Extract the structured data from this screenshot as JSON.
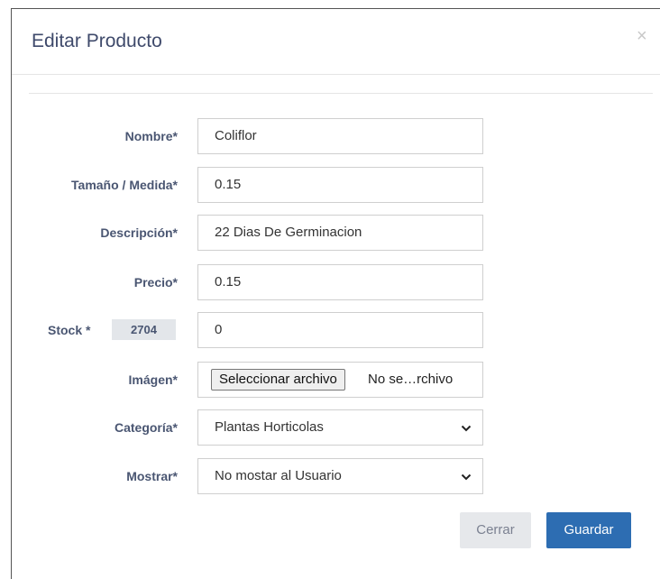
{
  "modal": {
    "title": "Editar Producto",
    "close_glyph": "×"
  },
  "form": {
    "nombre": {
      "label": "Nombre*",
      "value": "Coliflor"
    },
    "tamano": {
      "label": "Tamaño / Medida*",
      "value": "0.15"
    },
    "descripcion": {
      "label": "Descripción*",
      "value": "22 Dias De Germinacion"
    },
    "precio": {
      "label": "Precio*",
      "value": "0.15"
    },
    "stock": {
      "label": "Stock *",
      "current": "2704",
      "value": "0"
    },
    "imagen": {
      "label": "Imágen*",
      "button": "Seleccionar archivo",
      "filename": "No se…rchivo"
    },
    "categoria": {
      "label": "Categoría*",
      "selected": "Plantas Horticolas"
    },
    "mostrar": {
      "label": "Mostrar*",
      "selected": "No mostar al Usuario"
    }
  },
  "footer": {
    "cancel_label": "Cerrar",
    "save_label": "Guardar"
  },
  "icons": {
    "close": "close-icon",
    "chevron": "chevron-down-icon"
  },
  "colors": {
    "primary": "#2d6db2",
    "label": "#4a5672",
    "title": "#3f4a6b",
    "secondary_button": "#e6e8eb"
  }
}
